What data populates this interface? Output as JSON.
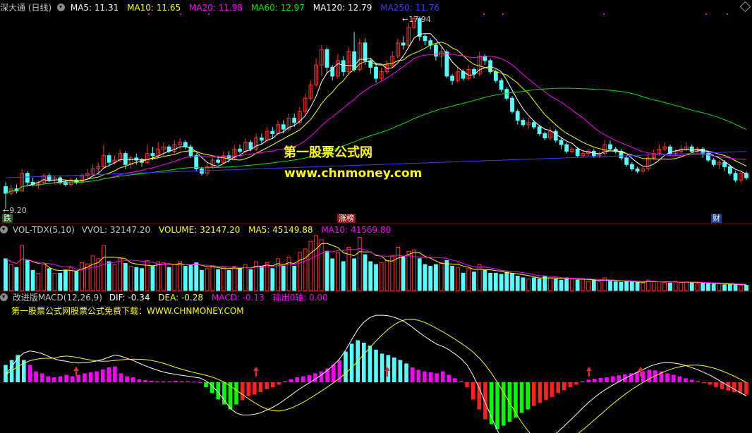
{
  "header_main": {
    "name": "深大通 (日线)",
    "ma5": "MA5: 11.31",
    "ma10": "MA10: 11.65",
    "ma20": "MA20: 11.98",
    "ma60": "MA60: 12.97",
    "ma120": "MA120: 12.79",
    "ma250": "MA250: 11.76"
  },
  "header_vol": {
    "name": "VOL-TDX(5,10)",
    "vvol": "VVOL: 32147.20",
    "volume": "VOLUME: 32147.20",
    "ma5": "MA5: 45149.88",
    "ma10": "MA10: 41569.80"
  },
  "header_macd": {
    "name": "改进版MACD(12,26,9)",
    "dif": "DIF: -0.34",
    "dea": "DEA: -0.28",
    "macd": "MACD: -0.13",
    "zero": "输出0轴: 0.00"
  },
  "macd_note": "第一股票公式网股票公式免费下载：WWW.CHNMONEY.COM",
  "watermark": {
    "line1": "第一股票公式网",
    "line2": "www.chnmoney.com"
  },
  "annotations": {
    "high": "17.94",
    "low": "9.20"
  },
  "badges": {
    "b1": "跌",
    "b2": "涨榜",
    "b3": "财"
  },
  "colors": {
    "up": "#ff3232",
    "down": "#54ffff",
    "ma5": "#ffffff",
    "ma10": "#ffff00",
    "ma20": "#ff00ff",
    "ma60": "#00e600",
    "ma120": "#ffffff",
    "ma250": "#3c3cff",
    "hist_pos": "#ff00ff",
    "hist_pos_alt": "#54ffff",
    "hist_neg": "#ff2020",
    "hist_neg_alt": "#00ff00",
    "background": "#000000",
    "dif": "#ffffff",
    "dea": "#ffff00"
  },
  "chart_data": {
    "type": "candlestick",
    "price_range": [
      9.2,
      17.94
    ],
    "candles": [
      [
        10.2,
        9.9,
        10.4,
        9.2
      ],
      [
        9.9,
        10.1,
        10.3,
        9.8
      ],
      [
        10.1,
        10.0,
        10.3,
        9.9
      ],
      [
        10.0,
        10.8,
        11.0,
        10.0
      ],
      [
        10.8,
        10.4,
        10.9,
        10.2
      ],
      [
        10.4,
        10.3,
        10.6,
        10.2
      ],
      [
        10.3,
        10.4,
        10.5,
        10.1
      ],
      [
        10.4,
        10.7,
        10.8,
        10.3
      ],
      [
        10.7,
        10.5,
        10.8,
        10.4
      ],
      [
        10.5,
        10.6,
        10.7,
        10.3
      ],
      [
        10.6,
        10.4,
        10.7,
        10.3
      ],
      [
        10.4,
        10.3,
        10.5,
        10.2
      ],
      [
        10.3,
        10.5,
        10.6,
        10.2
      ],
      [
        10.5,
        10.4,
        10.6,
        10.3
      ],
      [
        10.4,
        10.7,
        10.8,
        10.3
      ],
      [
        10.7,
        10.8,
        11.0,
        10.6
      ],
      [
        10.8,
        11.0,
        11.2,
        10.7
      ],
      [
        11.0,
        11.1,
        11.3,
        10.8
      ],
      [
        11.1,
        11.6,
        12.1,
        11.0
      ],
      [
        11.6,
        11.3,
        11.7,
        11.1
      ],
      [
        11.3,
        11.4,
        11.6,
        11.2
      ],
      [
        11.4,
        11.7,
        11.9,
        11.3
      ],
      [
        11.7,
        11.2,
        11.8,
        11.0
      ],
      [
        11.2,
        11.5,
        11.6,
        11.0
      ],
      [
        11.5,
        11.4,
        11.7,
        11.2
      ],
      [
        11.4,
        11.3,
        11.5,
        11.1
      ],
      [
        11.3,
        11.7,
        12.1,
        11.2
      ],
      [
        11.7,
        11.6,
        12.0,
        11.4
      ],
      [
        11.6,
        11.9,
        12.2,
        11.5
      ],
      [
        11.9,
        12.0,
        12.2,
        11.6
      ],
      [
        12.0,
        11.8,
        12.1,
        11.7
      ],
      [
        11.8,
        12.1,
        12.3,
        11.7
      ],
      [
        12.1,
        12.2,
        12.4,
        11.9
      ],
      [
        12.2,
        12.0,
        12.3,
        11.9
      ],
      [
        12.0,
        11.6,
        12.1,
        11.5
      ],
      [
        11.6,
        11.0,
        11.7,
        10.9
      ],
      [
        11.0,
        10.8,
        11.1,
        10.7
      ],
      [
        10.8,
        11.1,
        11.3,
        10.7
      ],
      [
        11.1,
        11.4,
        11.5,
        11.0
      ],
      [
        11.4,
        11.3,
        11.6,
        11.2
      ],
      [
        11.3,
        11.6,
        11.8,
        11.2
      ],
      [
        11.6,
        11.5,
        11.8,
        11.3
      ],
      [
        11.5,
        11.9,
        12.1,
        11.4
      ],
      [
        11.9,
        11.8,
        12.1,
        11.7
      ],
      [
        11.8,
        12.2,
        12.4,
        11.7
      ],
      [
        12.2,
        11.9,
        12.3,
        11.8
      ],
      [
        11.9,
        12.4,
        12.6,
        11.8
      ],
      [
        12.4,
        12.3,
        12.6,
        12.1
      ],
      [
        12.3,
        12.7,
        12.9,
        12.2
      ],
      [
        12.7,
        12.6,
        12.9,
        12.4
      ],
      [
        12.6,
        13.0,
        13.2,
        12.5
      ],
      [
        13.0,
        12.8,
        13.2,
        12.6
      ],
      [
        12.8,
        13.3,
        13.5,
        12.7
      ],
      [
        13.3,
        13.1,
        13.5,
        12.9
      ],
      [
        13.1,
        13.6,
        13.8,
        13.0
      ],
      [
        13.6,
        14.2,
        14.4,
        13.5
      ],
      [
        14.2,
        14.8,
        15.0,
        14.1
      ],
      [
        14.8,
        15.7,
        16.0,
        14.7
      ],
      [
        15.7,
        16.4,
        16.6,
        15.2
      ],
      [
        16.4,
        15.6,
        16.5,
        15.3
      ],
      [
        15.6,
        15.2,
        15.7,
        15.0
      ],
      [
        15.2,
        15.9,
        16.2,
        15.1
      ],
      [
        15.9,
        15.4,
        16.1,
        15.2
      ],
      [
        15.4,
        16.3,
        16.5,
        15.3
      ],
      [
        16.3,
        15.5,
        17.2,
        15.4
      ],
      [
        15.5,
        16.7,
        16.9,
        15.4
      ],
      [
        16.7,
        15.9,
        16.9,
        15.7
      ],
      [
        15.9,
        15.6,
        16.0,
        15.3
      ],
      [
        15.6,
        15.1,
        15.8,
        14.9
      ],
      [
        15.1,
        15.4,
        15.6,
        15.0
      ],
      [
        15.4,
        15.7,
        15.9,
        15.3
      ],
      [
        15.7,
        16.1,
        16.3,
        15.6
      ],
      [
        16.1,
        16.7,
        16.9,
        16.0
      ],
      [
        16.7,
        16.6,
        17.0,
        16.4
      ],
      [
        16.6,
        17.4,
        17.6,
        16.5
      ],
      [
        17.4,
        17.8,
        17.94,
        17.3
      ],
      [
        17.8,
        17.0,
        17.9,
        16.8
      ],
      [
        17.0,
        16.8,
        17.1,
        16.6
      ],
      [
        16.8,
        16.6,
        16.9,
        16.4
      ],
      [
        16.6,
        16.1,
        16.7,
        15.9
      ],
      [
        16.1,
        16.3,
        16.5,
        15.6
      ],
      [
        16.3,
        15.2,
        16.4,
        15.1
      ],
      [
        15.2,
        15.0,
        15.3,
        14.8
      ],
      [
        15.0,
        15.4,
        15.6,
        14.9
      ],
      [
        15.4,
        15.1,
        15.5,
        15.0
      ],
      [
        15.1,
        15.5,
        15.7,
        15.0
      ],
      [
        15.5,
        15.3,
        15.6,
        15.1
      ],
      [
        15.3,
        16.1,
        16.3,
        15.2
      ],
      [
        16.1,
        15.9,
        16.2,
        15.7
      ],
      [
        15.9,
        15.4,
        16.0,
        15.3
      ],
      [
        15.4,
        15.0,
        15.5,
        14.9
      ],
      [
        15.0,
        14.6,
        15.1,
        14.5
      ],
      [
        14.6,
        14.2,
        14.7,
        14.1
      ],
      [
        14.2,
        13.6,
        14.3,
        13.5
      ],
      [
        13.6,
        13.2,
        13.7,
        13.0
      ],
      [
        13.2,
        13.0,
        13.3,
        12.9
      ],
      [
        13.0,
        13.1,
        13.3,
        12.8
      ],
      [
        13.1,
        12.9,
        13.2,
        12.8
      ],
      [
        12.9,
        12.6,
        13.0,
        12.5
      ],
      [
        12.6,
        12.4,
        12.7,
        12.3
      ],
      [
        12.4,
        12.7,
        12.9,
        12.3
      ],
      [
        12.7,
        12.3,
        12.8,
        12.2
      ],
      [
        12.3,
        12.1,
        12.4,
        11.9
      ],
      [
        12.1,
        11.8,
        12.2,
        11.7
      ],
      [
        11.8,
        11.9,
        12.0,
        11.7
      ],
      [
        11.9,
        11.6,
        12.0,
        11.5
      ],
      [
        11.6,
        11.7,
        11.8,
        11.5
      ],
      [
        11.7,
        11.8,
        11.9,
        11.6
      ],
      [
        11.8,
        11.6,
        11.9,
        11.5
      ],
      [
        11.6,
        11.7,
        11.8,
        11.5
      ],
      [
        11.7,
        12.1,
        12.3,
        11.6
      ],
      [
        12.1,
        11.9,
        12.3,
        11.8
      ],
      [
        11.9,
        11.8,
        12.0,
        11.7
      ],
      [
        11.8,
        11.5,
        11.9,
        11.4
      ],
      [
        11.5,
        11.2,
        11.6,
        11.1
      ],
      [
        11.2,
        11.0,
        11.3,
        10.9
      ],
      [
        11.0,
        10.9,
        11.1,
        10.8
      ],
      [
        10.9,
        11.0,
        11.1,
        10.8
      ],
      [
        11.0,
        11.5,
        11.7,
        10.9
      ],
      [
        11.5,
        11.7,
        11.9,
        11.4
      ],
      [
        11.7,
        11.9,
        12.1,
        11.6
      ],
      [
        11.9,
        12.0,
        12.2,
        11.8
      ],
      [
        12.0,
        11.7,
        12.1,
        11.6
      ],
      [
        11.7,
        11.8,
        11.9,
        11.6
      ],
      [
        11.8,
        11.9,
        12.1,
        11.7
      ],
      [
        11.9,
        12.0,
        12.2,
        11.8
      ],
      [
        12.0,
        11.8,
        12.1,
        11.7
      ],
      [
        11.8,
        11.9,
        12.0,
        11.7
      ],
      [
        11.9,
        11.7,
        12.0,
        11.5
      ],
      [
        11.7,
        11.4,
        11.8,
        11.3
      ],
      [
        11.4,
        11.2,
        11.5,
        11.1
      ],
      [
        11.2,
        11.3,
        11.4,
        11.0
      ],
      [
        11.3,
        11.1,
        11.4,
        10.9
      ],
      [
        11.1,
        10.8,
        11.2,
        10.7
      ],
      [
        10.8,
        10.5,
        10.9,
        10.4
      ],
      [
        10.5,
        10.8,
        10.9,
        10.4
      ],
      [
        10.8,
        10.6,
        10.9,
        10.5
      ]
    ],
    "volume": [
      0.55,
      0.45,
      0.4,
      0.78,
      0.52,
      0.35,
      0.3,
      0.45,
      0.38,
      0.3,
      0.3,
      0.35,
      0.4,
      0.33,
      0.48,
      0.46,
      0.6,
      0.55,
      0.78,
      0.5,
      0.45,
      0.55,
      0.47,
      0.42,
      0.4,
      0.38,
      0.52,
      0.42,
      0.5,
      0.48,
      0.4,
      0.45,
      0.5,
      0.42,
      0.43,
      0.48,
      0.35,
      0.38,
      0.42,
      0.36,
      0.4,
      0.35,
      0.42,
      0.38,
      0.45,
      0.36,
      0.5,
      0.42,
      0.48,
      0.38,
      0.55,
      0.42,
      0.58,
      0.42,
      0.66,
      0.72,
      0.85,
      0.95,
      0.88,
      0.68,
      0.55,
      0.66,
      0.5,
      0.75,
      0.55,
      0.92,
      0.62,
      0.5,
      0.45,
      0.48,
      0.52,
      0.6,
      0.75,
      0.58,
      0.68,
      0.7,
      0.55,
      0.45,
      0.42,
      0.45,
      0.48,
      0.52,
      0.42,
      0.4,
      0.3,
      0.38,
      0.32,
      0.45,
      0.35,
      0.3,
      0.3,
      0.28,
      0.32,
      0.3,
      0.25,
      0.22,
      0.2,
      0.22,
      0.2,
      0.25,
      0.22,
      0.2,
      0.18,
      0.22,
      0.2,
      0.18,
      0.2,
      0.16,
      0.18,
      0.15,
      0.22,
      0.16,
      0.15,
      0.14,
      0.16,
      0.15,
      0.14,
      0.13,
      0.18,
      0.16,
      0.15,
      0.14,
      0.13,
      0.16,
      0.14,
      0.15,
      0.13,
      0.12,
      0.14,
      0.12,
      0.11,
      0.12,
      0.1,
      0.11,
      0.1,
      0.09,
      0.09
    ],
    "macd_hist": [
      0.35,
      0.45,
      0.55,
      0.45,
      0.35,
      0.22,
      0.18,
      0.12,
      0.1,
      0.12,
      0.15,
      0.12,
      0.15,
      0.18,
      0.2,
      0.22,
      0.26,
      0.3,
      0.32,
      0.18,
      0.12,
      0.1,
      0.06,
      0.04,
      0.03,
      0.02,
      0.02,
      0.02,
      0.03,
      0.02,
      0.02,
      0.01,
      0.0,
      -0.1,
      -0.22,
      -0.35,
      -0.45,
      -0.55,
      -0.45,
      -0.36,
      -0.28,
      -0.25,
      -0.2,
      -0.14,
      -0.1,
      -0.05,
      0.02,
      0.06,
      0.1,
      0.12,
      0.14,
      0.18,
      0.22,
      0.28,
      0.36,
      0.44,
      0.62,
      0.78,
      0.85,
      0.8,
      0.74,
      0.66,
      0.58,
      0.55,
      0.5,
      0.45,
      0.38,
      0.3,
      0.25,
      0.22,
      0.2,
      0.18,
      0.22,
      0.15,
      0.08,
      0.02,
      -0.1,
      -0.35,
      -0.55,
      -0.75,
      -0.85,
      -0.95,
      -0.88,
      -0.8,
      -0.72,
      -0.62,
      -0.55,
      -0.48,
      -0.42,
      -0.36,
      -0.3,
      -0.22,
      -0.16,
      -0.1,
      -0.05,
      0.02,
      0.05,
      0.07,
      0.09,
      0.1,
      0.12,
      0.14,
      0.16,
      0.18,
      0.2,
      0.22,
      0.25,
      0.24,
      0.22,
      0.18,
      0.15,
      0.12,
      0.08,
      0.05,
      0.02,
      -0.02,
      -0.05,
      -0.1,
      -0.14,
      -0.17,
      -0.2,
      -0.22,
      -0.25
    ],
    "macd_hist_alt_ranges": [
      [
        0,
        3
      ],
      [
        33,
        38
      ],
      [
        56,
        66
      ],
      [
        80,
        86
      ]
    ]
  }
}
